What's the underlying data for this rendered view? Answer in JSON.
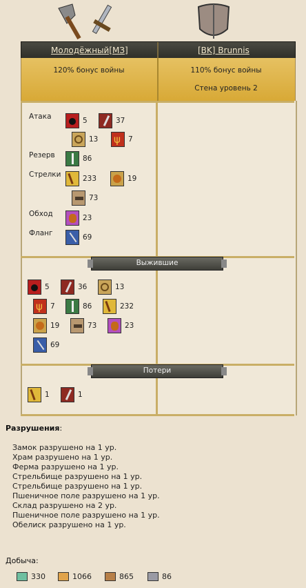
{
  "header": {
    "attacker_name": "Молодёжный[МЗ]",
    "defender_name": "[BK] Brunnis"
  },
  "bonus": {
    "attacker_bonus": "120% бонус войны",
    "defender_bonus": "110% бонус войны",
    "defender_wall": "Стена уровень 2"
  },
  "attack": {
    "labels": {
      "attack": "Атака",
      "reserve": "Резерв",
      "shooters": "Стрелки",
      "bypass": "Обход",
      "flank": "Фланг"
    },
    "attack_units": [
      {
        "icon": "bomb-icon",
        "count": "5"
      },
      {
        "icon": "sword-icon",
        "count": "37"
      },
      {
        "icon": "horn-icon",
        "count": "13"
      },
      {
        "icon": "trident-icon",
        "count": "7"
      }
    ],
    "reserve_units": [
      {
        "icon": "green-warrior-icon",
        "count": "86"
      }
    ],
    "shooter_units": [
      {
        "icon": "bow-icon",
        "count": "233"
      },
      {
        "icon": "shield-unit-icon",
        "count": "19"
      },
      {
        "icon": "cannon-icon",
        "count": "73"
      }
    ],
    "bypass_units": [
      {
        "icon": "purple-unit-icon",
        "count": "23"
      }
    ],
    "flank_units": [
      {
        "icon": "spear-icon",
        "count": "69"
      }
    ]
  },
  "survivors": {
    "title": "Выжившие",
    "units": [
      {
        "icon": "bomb-icon",
        "count": "5"
      },
      {
        "icon": "sword-icon",
        "count": "36"
      },
      {
        "icon": "horn-icon",
        "count": "13"
      },
      {
        "icon": "trident-icon",
        "count": "7"
      },
      {
        "icon": "green-warrior-icon",
        "count": "86"
      },
      {
        "icon": "bow-icon",
        "count": "232"
      },
      {
        "icon": "shield-unit-icon",
        "count": "19"
      },
      {
        "icon": "cannon-icon",
        "count": "73"
      },
      {
        "icon": "purple-unit-icon",
        "count": "23"
      },
      {
        "icon": "spear-icon",
        "count": "69"
      }
    ]
  },
  "losses": {
    "title": "Потери",
    "units": [
      {
        "icon": "bow-icon",
        "count": "1"
      },
      {
        "icon": "sword-icon",
        "count": "1"
      }
    ]
  },
  "destruction": {
    "title": "Разрушения",
    "colon": ":",
    "lines": [
      "Замок разрушено на 1 ур.",
      "Храм разрушено на 1 ур.",
      "Ферма разрушено на 1 ур.",
      "Стрельбище разрушено на 1 ур.",
      "Стрельбище разрушено на 1 ур.",
      "Пшеничное поле разрушено на 1 ур.",
      "Склад разрушено на 2 ур.",
      "Пшеничное поле разрушено на 1 ур.",
      "Обелиск разрушено на 1 ур."
    ]
  },
  "loot": {
    "title": "Добыча",
    "colon": ":",
    "items": [
      {
        "icon": "flask-icon",
        "amount": "330"
      },
      {
        "icon": "bread-icon",
        "amount": "1066"
      },
      {
        "icon": "wood-icon",
        "amount": "865"
      },
      {
        "icon": "stone-icon",
        "amount": "86"
      }
    ]
  }
}
